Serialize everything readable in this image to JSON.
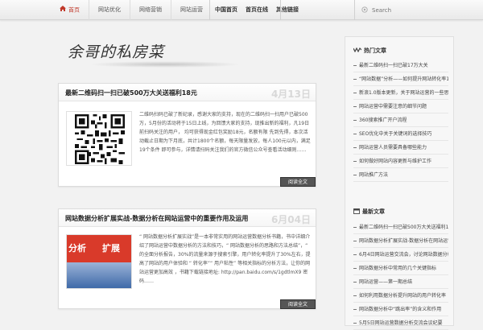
{
  "nav": {
    "home": "首页",
    "items": [
      "网站优化",
      "网络营销",
      "网站运营"
    ],
    "mid_items": [
      "中国首页",
      "首页在线",
      "其他链接"
    ]
  },
  "search": {
    "placeholder": "Search"
  },
  "logo": {
    "text": "余哥的私房菜"
  },
  "posts": [
    {
      "title": "最新二维码扫一扫已破500万大关送福利18元",
      "date": "4月13日",
      "text": "二维码扫码已破了新纪录，感谢大家的支持，现在的二维码扫一扫用户已破500万，5月份的活动将于15日上线，为回馈大家的支持，现推出新的福利，凡19日前扫码关注的用户， 均可获得现金红包奖励18元，名额有限 先到先得，本次活动截止日期为下月底，共计1800个名额，每天限量发放，每人100元以内，满足19个条件 即可参与，详情请扫码关注我们的官方微信公众号查看活动细则……",
      "more": "阅读全文"
    },
    {
      "title": "网站数据分析扩展实战-数据分析在网站运营中的重要作用及运用",
      "date": "6月04日",
      "text": "“ 网站数据分析扩展实战”是一本非常实用的网站运营数据分析书籍，书中详细介绍了网站运营中数据分析的方法和技巧，“ 网站数据分析的思路和方法总结”，“ 的全面分析报告，30%的流量来源于搜索引擎，用户转化率提升了30%左右，提高了网站的用户体验和 “ 转化率”“ 用户粘性” 等相关指标的分析方法，让你的网站运营更加高效 ，书籍下载链接地址: http://pan.baidu.com/s/1gdtlmX9 密码……",
      "more": "阅读全文",
      "thumb_words": [
        "分析",
        "扩展"
      ]
    }
  ],
  "sidebar": {
    "hot_title": "热门文章",
    "hot_items": [
      "最新二维码扫一扫已破17万大关",
      "“网站数据”分析——如何提升网站转化率10%的实战方法",
      "新浪1.0版本更新，关于网站运营的一些思考",
      "网站运营中需要注意的细节问题",
      "360搜索推广开户流程",
      "SEO优化中关于关键词的选择技巧",
      "网站运营人员需要具备哪些能力",
      "如何做好网站内容更新与维护工作",
      "网站推广方法"
    ],
    "latest_title": "最新文章",
    "latest_items": [
      "最新二维码扫一扫已破500万大关送福利18元",
      "网站数据分析扩展实战-数据分析在网站运营中的重要作用及运用",
      "6月4日网站运营交流会，讨论网站数据分析与用户体验",
      "网站数据分析中常用的几个关键指标",
      "网站运营——第一期总结",
      "如何利用数据分析提升网站的用户转化率",
      "网站数据分析中“跳出率”的含义和作用",
      "5月5日网站运营数据分析交流会议纪要"
    ]
  }
}
